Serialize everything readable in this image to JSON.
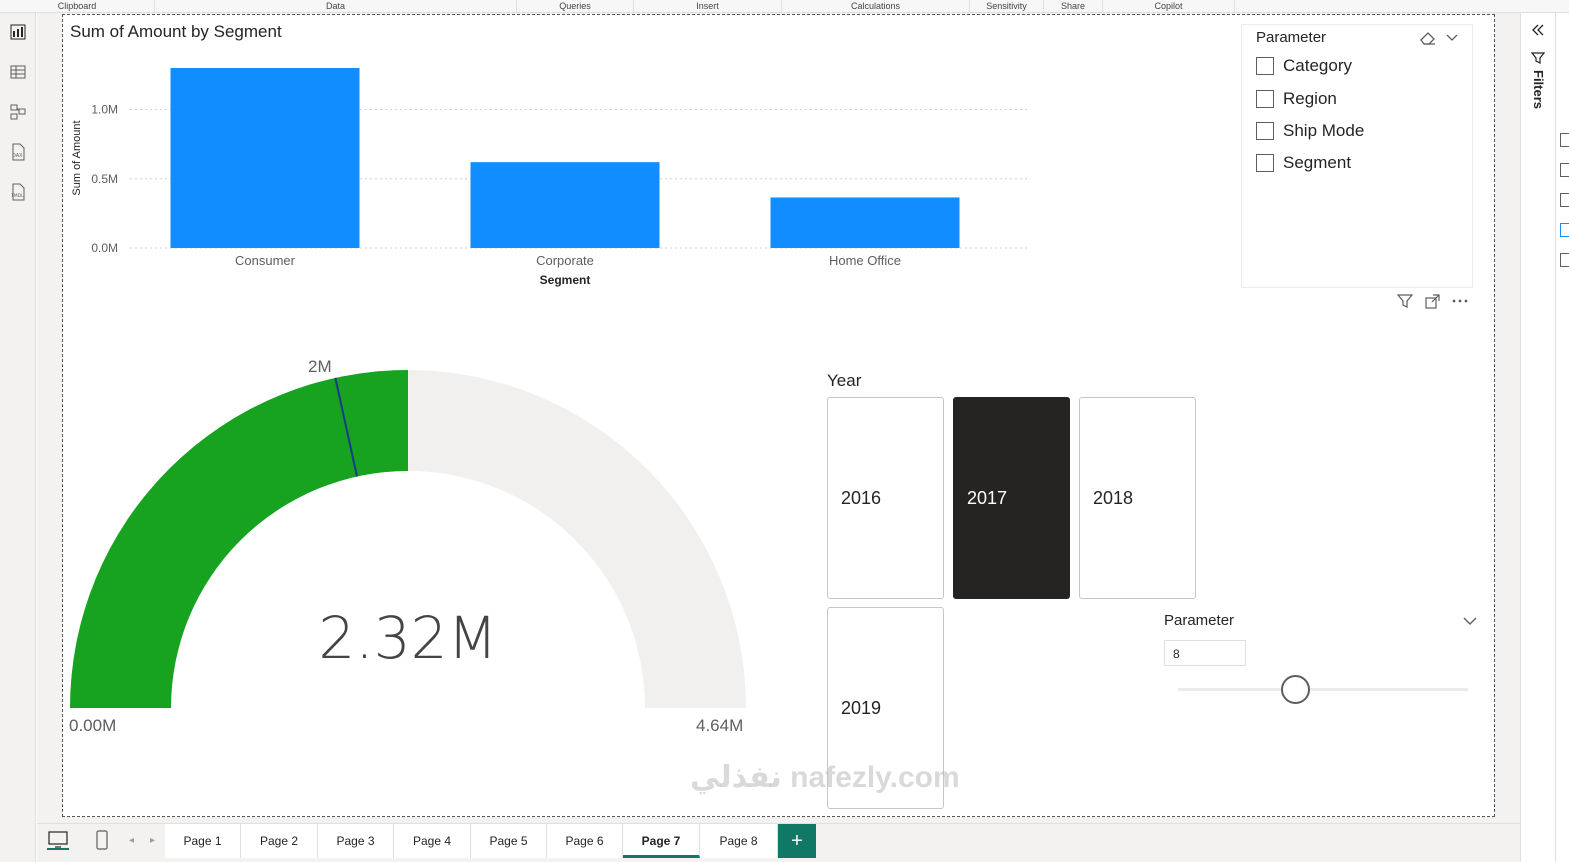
{
  "ribbon": {
    "groups": [
      "Clipboard",
      "Data",
      "Queries",
      "Insert",
      "Calculations",
      "Sensitivity",
      "Share",
      "Copilot"
    ]
  },
  "left_rail": {
    "icons": [
      "report-view-icon",
      "table-view-icon",
      "model-view-icon",
      "dax-query-icon",
      "tmdl-view-icon"
    ]
  },
  "filters": {
    "label": "Filters"
  },
  "bar_chart": {
    "title": "Sum of Amount by Segment",
    "chart_data": {
      "type": "bar",
      "title": "Sum of Amount by Segment",
      "xlabel": "Segment",
      "ylabel": "Sum of Amount",
      "categories": [
        "Consumer",
        "Corporate",
        "Home Office"
      ],
      "values": [
        1300000,
        620000,
        365000
      ],
      "yticks": [
        "0.0M",
        "0.5M",
        "1.0M"
      ],
      "ylim": [
        0,
        1300000
      ],
      "grid": true,
      "color": "#118dff"
    }
  },
  "slicer": {
    "title": "Parameter",
    "items": [
      "Category",
      "Region",
      "Ship Mode",
      "Segment"
    ]
  },
  "gauge": {
    "value_label": "2.32M",
    "min_label": "0.00M",
    "max_label": "4.64M",
    "target_label": "2M",
    "value": 2320000,
    "min": 0,
    "max": 4640000,
    "target": 2000000,
    "fill_color": "#17a21f",
    "track_color": "#f1f0ef",
    "target_color": "#173a8a"
  },
  "year_slicer": {
    "title": "Year",
    "tiles": [
      "2016",
      "2017",
      "2018",
      "2019"
    ],
    "selected": "2017"
  },
  "parameter_slicer": {
    "title": "Parameter",
    "value": "8"
  },
  "tabs": [
    "Page 1",
    "Page 2",
    "Page 3",
    "Page 4",
    "Page 5",
    "Page 6",
    "Page 7",
    "Page 8"
  ],
  "active_tab": "Page 7",
  "add_page": "+",
  "watermark": "نفذلي nafezly.com"
}
